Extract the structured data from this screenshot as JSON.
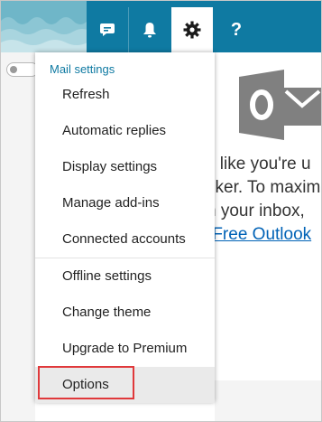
{
  "menu": {
    "heading": "Mail settings",
    "items": [
      {
        "label": "Refresh"
      },
      {
        "label": "Automatic replies"
      },
      {
        "label": "Display settings"
      },
      {
        "label": "Manage add-ins"
      },
      {
        "label": "Connected accounts"
      },
      {
        "label": "Offline settings"
      },
      {
        "label": "Change theme"
      },
      {
        "label": "Upgrade to Premium"
      },
      {
        "label": "Options"
      }
    ]
  },
  "header": {
    "buttons": [
      {
        "icon": "feedback-icon"
      },
      {
        "icon": "bell-icon"
      },
      {
        "icon": "gear-icon",
        "active": true
      },
      {
        "icon": "help-icon",
        "label": "?"
      }
    ]
  },
  "promo": {
    "line1": "s like you're u",
    "line2": "cker. To maxim",
    "line3": "n your inbox,",
    "link": "-Free Outlook"
  },
  "colors": {
    "header": "#0f7aa2",
    "wave": "#6fb6c8",
    "heading": "#0f7aa2",
    "highlight_box": "#e0393b",
    "link": "#0062b6"
  }
}
